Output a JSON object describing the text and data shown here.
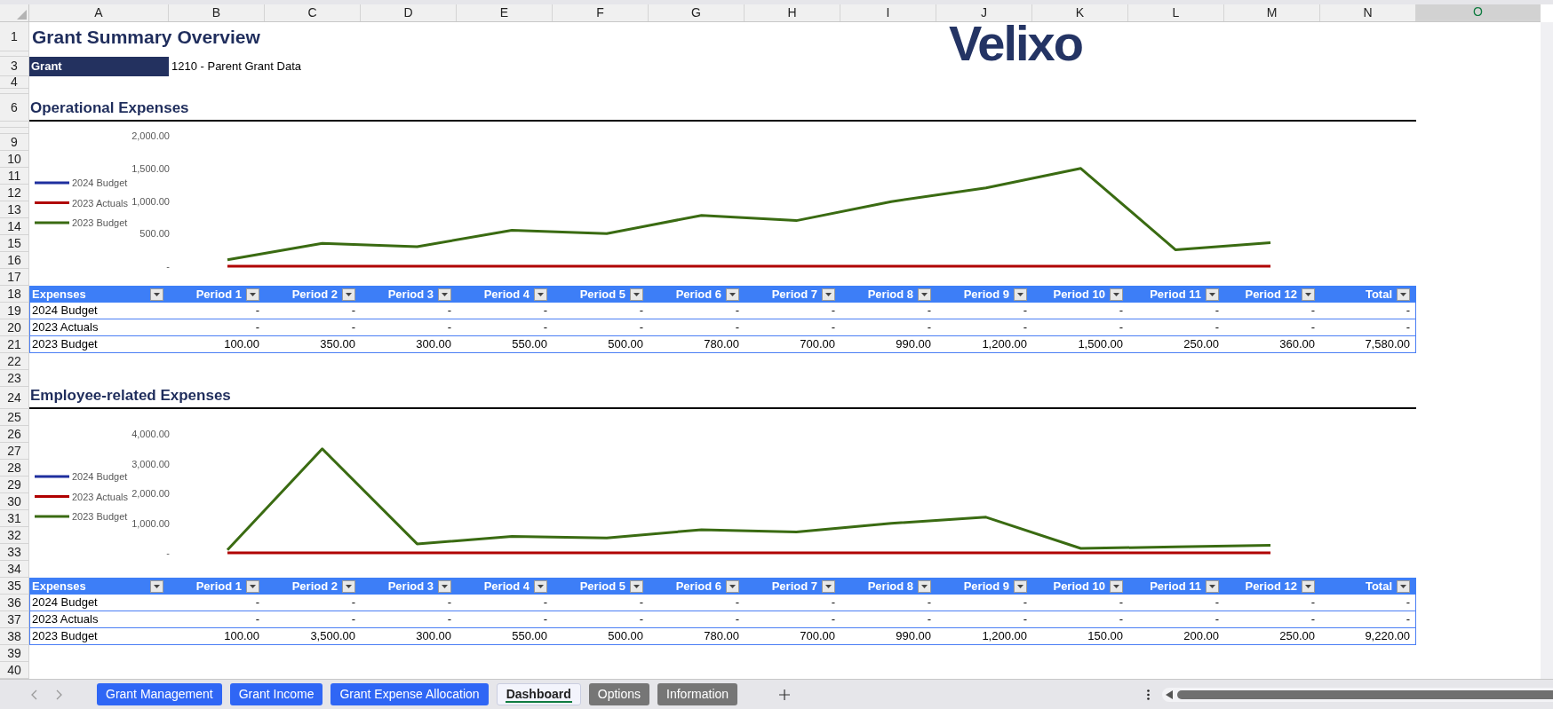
{
  "columns": [
    {
      "label": "A",
      "selected": false
    },
    {
      "label": "B",
      "selected": false
    },
    {
      "label": "C",
      "selected": false
    },
    {
      "label": "D",
      "selected": false
    },
    {
      "label": "E",
      "selected": false
    },
    {
      "label": "F",
      "selected": false
    },
    {
      "label": "G",
      "selected": false
    },
    {
      "label": "H",
      "selected": false
    },
    {
      "label": "I",
      "selected": false
    },
    {
      "label": "J",
      "selected": false
    },
    {
      "label": "K",
      "selected": false
    },
    {
      "label": "L",
      "selected": false
    },
    {
      "label": "M",
      "selected": false
    },
    {
      "label": "N",
      "selected": false
    },
    {
      "label": "O",
      "selected": true
    }
  ],
  "rows": [
    {
      "number": "1"
    },
    {
      "kind": "thin"
    },
    {
      "number": "3"
    },
    {
      "number": "4"
    },
    {
      "kind": "thin"
    },
    {
      "number": "6"
    },
    {
      "kind": "thin"
    },
    {
      "kind": "thin"
    },
    {
      "number": "9"
    },
    {
      "number": "10"
    },
    {
      "number": "11"
    },
    {
      "number": "12"
    },
    {
      "number": "13"
    },
    {
      "number": "14"
    },
    {
      "number": "15"
    },
    {
      "number": "16"
    },
    {
      "number": "17"
    },
    {
      "number": "18"
    },
    {
      "number": "19"
    },
    {
      "number": "20"
    },
    {
      "number": "21"
    },
    {
      "number": "22"
    },
    {
      "number": "23"
    },
    {
      "number": "24"
    },
    {
      "number": "25"
    },
    {
      "number": "26"
    },
    {
      "number": "27"
    },
    {
      "number": "28"
    },
    {
      "number": "29"
    },
    {
      "number": "30"
    },
    {
      "number": "31"
    },
    {
      "number": "32"
    },
    {
      "number": "33"
    },
    {
      "number": "34"
    },
    {
      "number": "35"
    },
    {
      "number": "36"
    },
    {
      "number": "37"
    },
    {
      "number": "38"
    },
    {
      "number": "39"
    },
    {
      "number": "40"
    }
  ],
  "title": "Grant Summary Overview",
  "logo": "Velixo",
  "grant": {
    "label": "Grant",
    "value": "1210 - Parent Grant Data"
  },
  "sections": [
    {
      "title": "Operational Expenses",
      "chart_data": {
        "type": "line",
        "legend": "left",
        "ylim": [
          0,
          2000
        ],
        "yticks": [
          {
            "value": 0,
            "label": "-"
          },
          {
            "value": 500,
            "label": "500.00"
          },
          {
            "value": 1000,
            "label": "1,000.00"
          },
          {
            "value": 1500,
            "label": "1,500.00"
          },
          {
            "value": 2000,
            "label": "2,000.00"
          }
        ],
        "series": [
          {
            "name": "2024 Budget",
            "color": "#1f2f9e",
            "values": [
              null,
              null,
              null,
              null,
              null,
              null,
              null,
              null,
              null,
              null,
              null,
              null
            ]
          },
          {
            "name": "2023 Actuals",
            "color": "#b00000",
            "values": [
              0,
              0,
              0,
              0,
              0,
              0,
              0,
              0,
              0,
              0,
              0,
              0
            ]
          },
          {
            "name": "2023 Budget",
            "color": "#3a6b12",
            "values": [
              100,
              350,
              300,
              550,
              500,
              780,
              700,
              990,
              1200,
              1500,
              250,
              360
            ]
          }
        ]
      },
      "table": {
        "columns": [
          "Expenses",
          "Period 1",
          "Period 2",
          "Period 3",
          "Period 4",
          "Period 5",
          "Period 6",
          "Period 7",
          "Period 8",
          "Period 9",
          "Period 10",
          "Period 11",
          "Period 12",
          "Total"
        ],
        "rows": [
          {
            "cells": [
              "2024 Budget",
              "-",
              "-",
              "-",
              "-",
              "-",
              "-",
              "-",
              "-",
              "-",
              "-",
              "-",
              "-",
              "-"
            ]
          },
          {
            "cells": [
              "2023 Actuals",
              "-",
              "-",
              "-",
              "-",
              "-",
              "-",
              "-",
              "-",
              "-",
              "-",
              "-",
              "-",
              "-"
            ]
          },
          {
            "cells": [
              "2023 Budget",
              "100.00",
              "350.00",
              "300.00",
              "550.00",
              "500.00",
              "780.00",
              "700.00",
              "990.00",
              "1,200.00",
              "1,500.00",
              "250.00",
              "360.00",
              "7,580.00"
            ]
          }
        ]
      }
    },
    {
      "title": "Employee-related Expenses",
      "chart_data": {
        "type": "line",
        "legend": "left",
        "ylim": [
          0,
          4000
        ],
        "yticks": [
          {
            "value": 0,
            "label": "-"
          },
          {
            "value": 1000,
            "label": "1,000.00"
          },
          {
            "value": 2000,
            "label": "2,000.00"
          },
          {
            "value": 3000,
            "label": "3,000.00"
          },
          {
            "value": 4000,
            "label": "4,000.00"
          }
        ],
        "series": [
          {
            "name": "2024 Budget",
            "color": "#1f2f9e",
            "values": [
              null,
              null,
              null,
              null,
              null,
              null,
              null,
              null,
              null,
              null,
              null,
              null
            ]
          },
          {
            "name": "2023 Actuals",
            "color": "#b00000",
            "values": [
              0,
              0,
              0,
              0,
              0,
              0,
              0,
              0,
              0,
              0,
              0,
              0
            ]
          },
          {
            "name": "2023 Budget",
            "color": "#3a6b12",
            "values": [
              100,
              3500,
              300,
              550,
              500,
              780,
              700,
              990,
              1200,
              150,
              200,
              250
            ]
          }
        ]
      },
      "table": {
        "columns": [
          "Expenses",
          "Period 1",
          "Period 2",
          "Period 3",
          "Period 4",
          "Period 5",
          "Period 6",
          "Period 7",
          "Period 8",
          "Period 9",
          "Period 10",
          "Period 11",
          "Period 12",
          "Total"
        ],
        "rows": [
          {
            "cells": [
              "2024 Budget",
              "-",
              "-",
              "-",
              "-",
              "-",
              "-",
              "-",
              "-",
              "-",
              "-",
              "-",
              "-",
              "-"
            ]
          },
          {
            "cells": [
              "2023 Actuals",
              "-",
              "-",
              "-",
              "-",
              "-",
              "-",
              "-",
              "-",
              "-",
              "-",
              "-",
              "-",
              "-"
            ]
          },
          {
            "cells": [
              "2023 Budget",
              "100.00",
              "3,500.00",
              "300.00",
              "550.00",
              "500.00",
              "780.00",
              "700.00",
              "990.00",
              "1,200.00",
              "150.00",
              "200.00",
              "250.00",
              "9,220.00"
            ]
          }
        ]
      }
    }
  ],
  "sheet_tabs": [
    {
      "label": "Grant Management",
      "color": "#2f66f5",
      "selected": false
    },
    {
      "label": "Grant Income",
      "color": "#2f66f5",
      "selected": false
    },
    {
      "label": "Grant Expense Allocation",
      "color": "#2f66f5",
      "selected": false
    },
    {
      "label": "Dashboard",
      "color": "#107c41",
      "selected": true
    },
    {
      "label": "Options",
      "color": "#767676",
      "selected": false
    },
    {
      "label": "Information",
      "color": "#767676",
      "selected": false
    }
  ]
}
